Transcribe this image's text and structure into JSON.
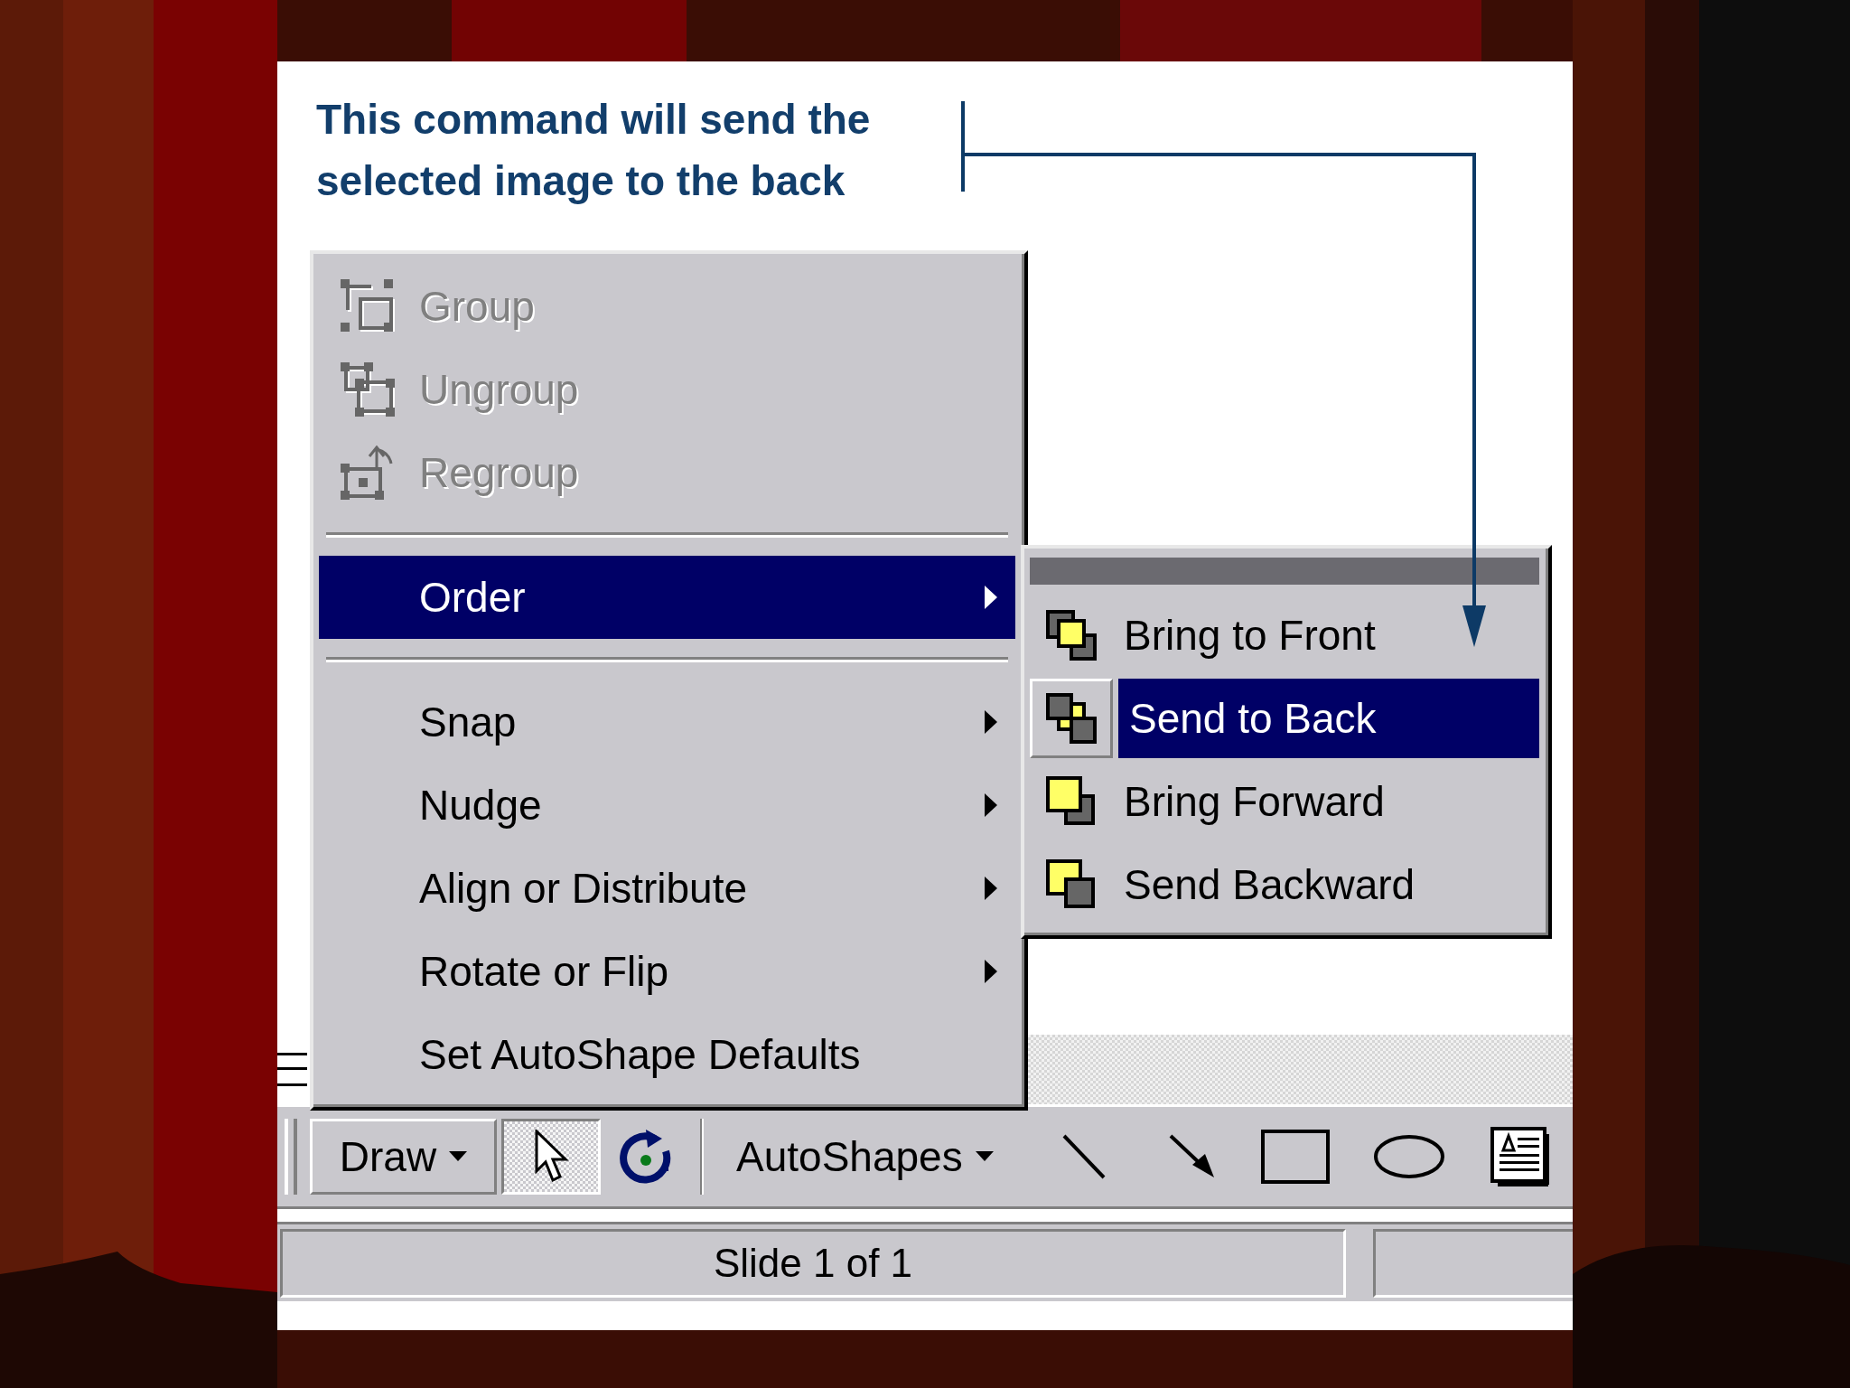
{
  "caption": "This command will send the selected image to the back",
  "menu": {
    "items": [
      {
        "kind": "command",
        "label": "Group",
        "disabled": true,
        "selected": false
      },
      {
        "kind": "command",
        "label": "Ungroup",
        "disabled": true,
        "selected": false
      },
      {
        "kind": "command",
        "label": "Regroup",
        "disabled": true,
        "selected": false
      },
      {
        "kind": "separator"
      },
      {
        "kind": "submenu",
        "label": "Order",
        "disabled": false,
        "selected": true
      },
      {
        "kind": "separator"
      },
      {
        "kind": "submenu",
        "label": "Snap",
        "disabled": false,
        "selected": false
      },
      {
        "kind": "submenu",
        "label": "Nudge",
        "disabled": false,
        "selected": false
      },
      {
        "kind": "submenu",
        "label": "Align or Distribute",
        "disabled": false,
        "selected": false
      },
      {
        "kind": "submenu",
        "label": "Rotate or Flip",
        "disabled": false,
        "selected": false
      },
      {
        "kind": "command",
        "label": "Set AutoShape Defaults",
        "disabled": false,
        "selected": false
      }
    ]
  },
  "submenu": {
    "items": [
      {
        "label": "Bring to Front",
        "selected": false
      },
      {
        "label": "Send to Back",
        "selected": true
      },
      {
        "label": "Bring Forward",
        "selected": false
      },
      {
        "label": "Send Backward",
        "selected": false
      }
    ]
  },
  "toolbar": {
    "draw_label": "Draw",
    "select_pressed": true,
    "autoshapes_label": "AutoShapes"
  },
  "status_bar": {
    "text": "Slide 1 of 1"
  }
}
